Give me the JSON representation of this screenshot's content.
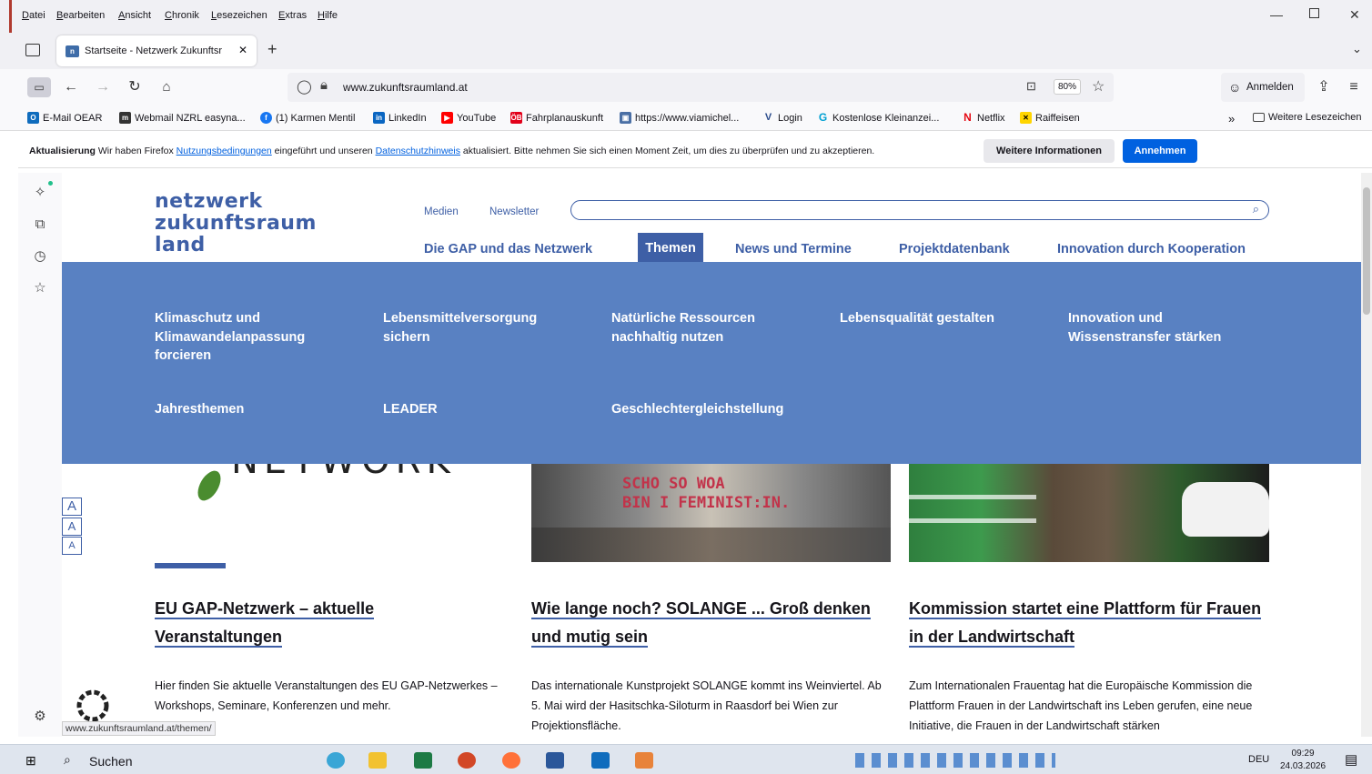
{
  "menubar": {
    "items": [
      "Datei",
      "Bearbeiten",
      "Ansicht",
      "Chronik",
      "Lesezeichen",
      "Extras",
      "Hilfe"
    ],
    "window_controls": [
      "minimize-icon",
      "maximize-icon",
      "close-icon"
    ]
  },
  "tab": {
    "title": "Startseite - Netzwerk Zukunftsr",
    "close": "✕",
    "new_tab": "+"
  },
  "navbar": {
    "url_domain": "www.zukunftsraumland.at",
    "url_prefix": "",
    "zoom": "80%",
    "signin": "Anmelden"
  },
  "bookmarks": [
    {
      "label": "E-Mail OEAR",
      "icon": "outlook-icon",
      "color": "#0f6cbd"
    },
    {
      "label": "Webmail NZRL easyna...",
      "icon": "webmail-icon",
      "color": "#333333"
    },
    {
      "label": "(1) Karmen Mentil",
      "icon": "facebook-icon",
      "color": "#1877f2"
    },
    {
      "label": "LinkedIn",
      "icon": "linkedin-icon",
      "color": "#0a66c2"
    },
    {
      "label": "YouTube",
      "icon": "youtube-icon",
      "color": "#ff0000"
    },
    {
      "label": "Fahrplanauskunft",
      "icon": "train-icon",
      "color": "#e2001a"
    },
    {
      "label": "https://www.viamichel...",
      "icon": "page-icon",
      "color": "#4a6fa5"
    },
    {
      "label": "Login",
      "icon": "login-icon",
      "color": "#2b4c8c"
    },
    {
      "label": "Kostenlose Kleinanzei...",
      "icon": "classifieds-icon",
      "color": "#00a0d2"
    },
    {
      "label": "Netflix",
      "icon": "netflix-icon",
      "color": "#e50914"
    },
    {
      "label": "Raiffeisen",
      "icon": "raiffeisen-icon",
      "color": "#ffd500"
    }
  ],
  "bookmarks_more": "Weitere Lesezeichen",
  "notification": {
    "bold": "Aktualisierung",
    "text1": " Wir haben Firefox ",
    "link1": "Nutzungsbedingungen",
    "text2": " eingeführt und unseren ",
    "link2": "Datenschutzhinweis",
    "text3": " aktualisiert. Bitte nehmen Sie sich einen Moment Zeit, um dies zu überprüfen und zu akzeptieren.",
    "more_button": "Weitere Informationen",
    "accept_button": "Annehmen"
  },
  "site": {
    "logo_lines": [
      "netzwerk",
      "zukunftsraum",
      "land"
    ],
    "top_links": [
      "Medien",
      "Newsletter"
    ],
    "main_nav": [
      "Die GAP und das Netzwerk",
      "Themen",
      "News und Termine",
      "Projektdatenbank",
      "Innovation durch Kooperation"
    ],
    "mega_menu": [
      "Klimaschutz und Klimawandelanpassung forcieren",
      "Lebensmittelversorgung sichern",
      "Natürliche Ressourcen nachhaltig nutzen",
      "Lebensqualität gestalten",
      "Innovation und Wissenstransfer stärken",
      "Jahresthemen",
      "LEADER",
      "Geschlechtergleichstellung"
    ],
    "font_size_buttons": [
      "A",
      "A",
      "A"
    ],
    "image_caption": "SCHO SO WOA\nBIN I FEMINIST:IN.",
    "articles": [
      {
        "title": "EU GAP-Netzwerk – aktuelle Veranstaltungen",
        "text": "Hier finden Sie aktuelle Veranstaltungen des EU GAP-Netzwerkes – Workshops, Seminare, Konferenzen und mehr."
      },
      {
        "title": "Wie lange noch? SOLANGE ... Groß denken und mutig sein",
        "text": "Das internationale Kunstprojekt SOLANGE kommt ins Weinviertel. Ab 5. Mai wird der Hasitschka-Siloturm in Raasdorf bei Wien zur Projektionsfläche."
      },
      {
        "title": "Kommission startet eine Plattform für Frauen in der Landwirtschaft",
        "text": "Zum Internationalen Frauentag hat die Europäische Kommission die Plattform Frauen in der Landwirtschaft ins Leben gerufen, eine neue Initiative, die Frauen in der Landwirtschaft stärken"
      }
    ],
    "status_url": "www.zukunftsraumland.at/themen/"
  },
  "taskbar": {
    "search": "Suchen",
    "lang": "DEU",
    "time": "09:29",
    "date": "24.03.2026"
  },
  "colors": {
    "brand_blue": "#3e5fa6",
    "mega_menu_bg": "#5981c2",
    "firefox_accent": "#0061e0"
  }
}
